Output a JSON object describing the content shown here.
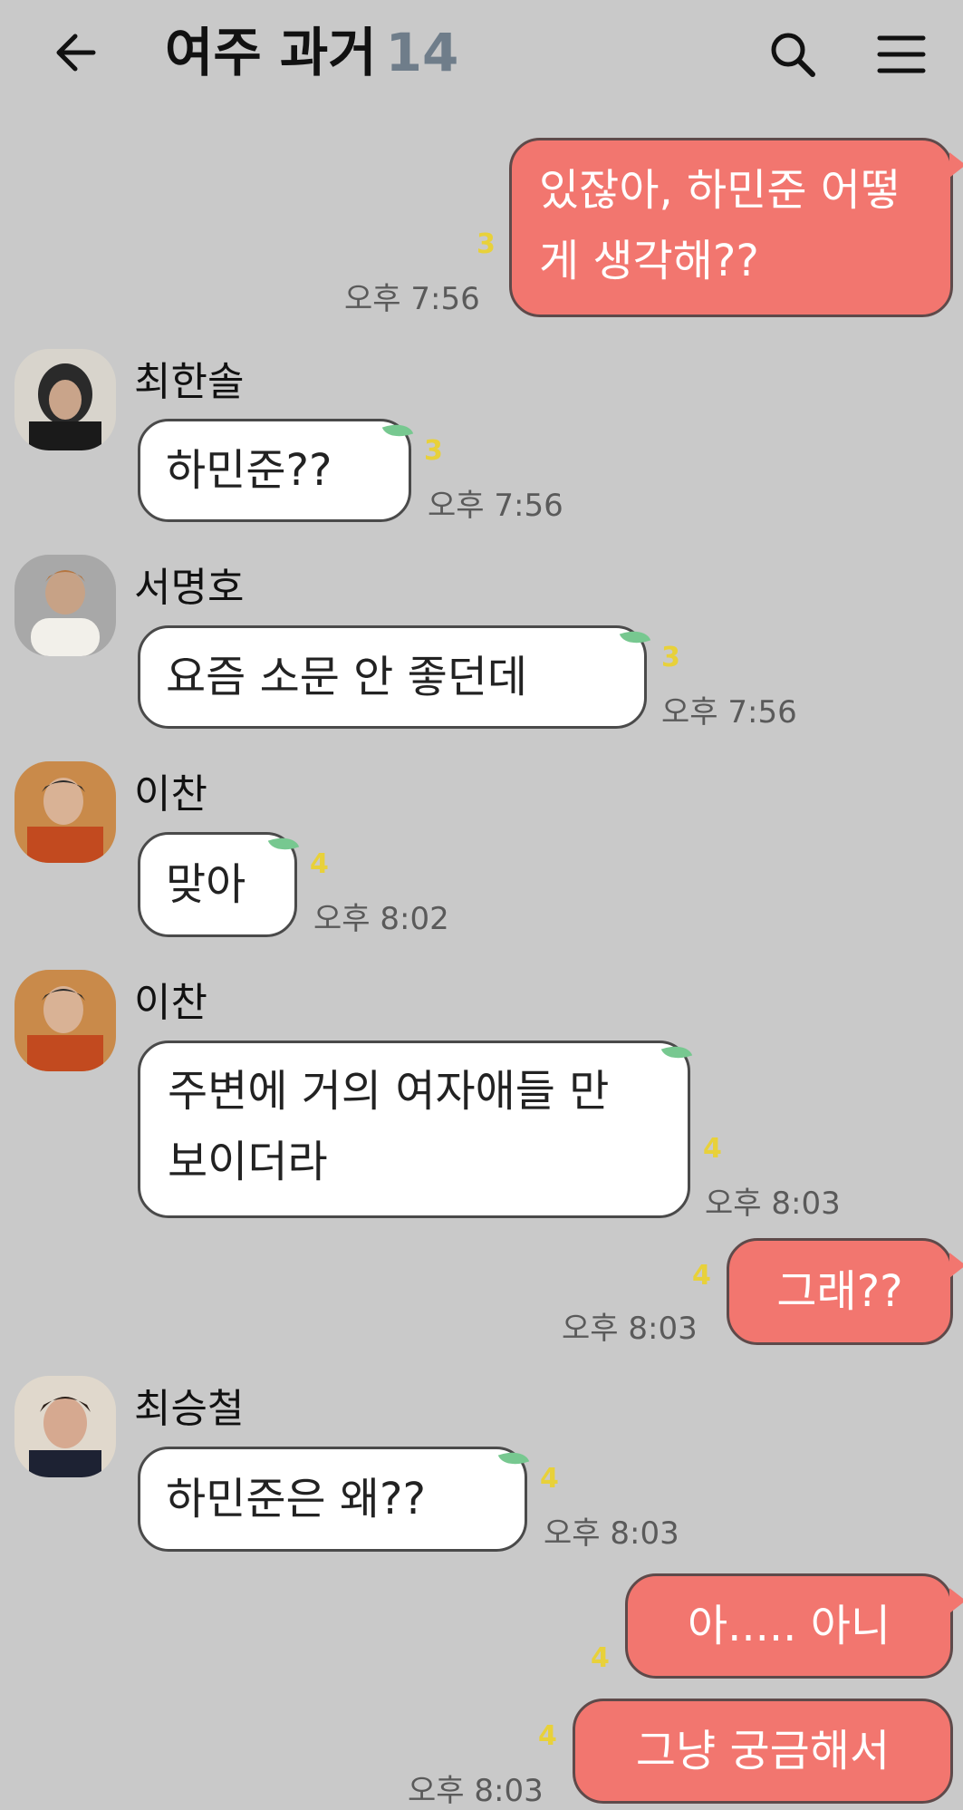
{
  "header": {
    "title": "여주 과거",
    "member_count": "14"
  },
  "messages": [
    {
      "sender": "",
      "text": "있잖아, 하민준 어떻게 생각해??",
      "unread": "3",
      "time": "오후 7:56"
    },
    {
      "sender": "최한솔",
      "text": "하민준??",
      "unread": "3",
      "time": "오후 7:56"
    },
    {
      "sender": "서명호",
      "text": "요즘 소문 안 좋던데",
      "unread": "3",
      "time": "오후 7:56"
    },
    {
      "sender": "이찬",
      "text": "맞아",
      "unread": "4",
      "time": "오후 8:02"
    },
    {
      "sender": "이찬",
      "text": "주변에 거의 여자애들 만 보이더라",
      "unread": "4",
      "time": "오후 8:03"
    },
    {
      "sender": "",
      "text": "그래??",
      "unread": "4",
      "time": "오후 8:03"
    },
    {
      "sender": "최승철",
      "text": "하민준은 왜??",
      "unread": "4",
      "time": "오후 8:03"
    },
    {
      "sender": "",
      "text": "아..... 아니",
      "unread": "4",
      "time": ""
    },
    {
      "sender": "",
      "text": "그냥 궁금해서",
      "unread": "4",
      "time": "오후 8:03"
    }
  ],
  "icons": {
    "back": "arrow-left-icon",
    "search": "search-icon",
    "menu": "hamburger-menu-icon"
  },
  "colors": {
    "background": "#c9c9c9",
    "outgoing_bubble": "#f2766f",
    "incoming_bubble": "#ffffff",
    "unread_count": "#e8d13a",
    "member_count": "#6f7d8a"
  }
}
